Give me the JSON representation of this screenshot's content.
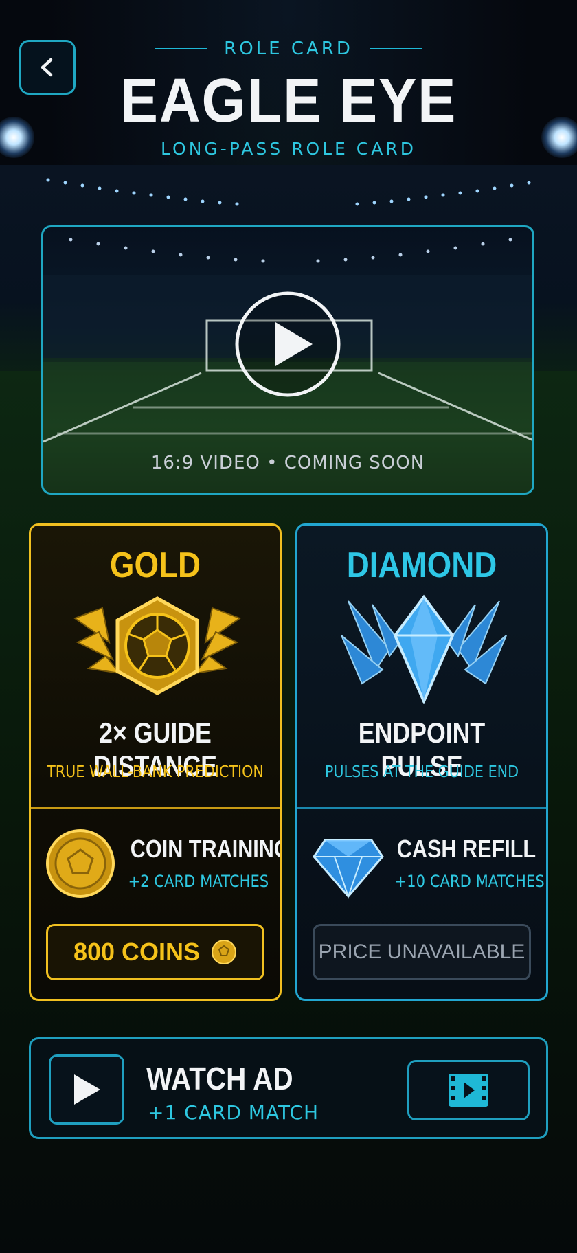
{
  "header": {
    "back_icon": "chevron-left-icon",
    "eyebrow": "ROLE CARD",
    "title": "EAGLE EYE",
    "subtitle": "LONG-PASS ROLE CARD"
  },
  "video": {
    "play_icon": "play-icon",
    "caption": "16:9 VIDEO • COMING SOON"
  },
  "tiers": [
    {
      "name": "GOLD",
      "emblem_icon": "gold-winged-ball-emblem-icon",
      "perk_title": "2× GUIDE DISTANCE",
      "perk_sub": "TRUE WALL-BANK PREDICTION",
      "offer_icon": "gold-coin-icon",
      "offer_title": "COIN TRAINING",
      "offer_sub": "+2 CARD MATCHES",
      "price": "800 COINS",
      "price_icon": "coin-icon",
      "accent": "#f5c21a"
    },
    {
      "name": "DIAMOND",
      "emblem_icon": "winged-diamond-emblem-icon",
      "perk_title": "ENDPOINT PULSE",
      "perk_sub": "PULSES AT THE GUIDE END",
      "offer_icon": "diamond-gem-icon",
      "offer_title": "CASH REFILL",
      "offer_sub": "+10 CARD MATCHES",
      "price": "PRICE UNAVAILABLE",
      "accent": "#2ec7e6"
    }
  ],
  "watch_ad": {
    "play_icon": "play-icon",
    "title": "WATCH AD",
    "sub": "+1 CARD MATCH",
    "button_icon": "video-film-icon"
  },
  "colors": {
    "accent_cyan": "#2ec7e0",
    "gold": "#f5c21a",
    "background": "#05080e"
  }
}
